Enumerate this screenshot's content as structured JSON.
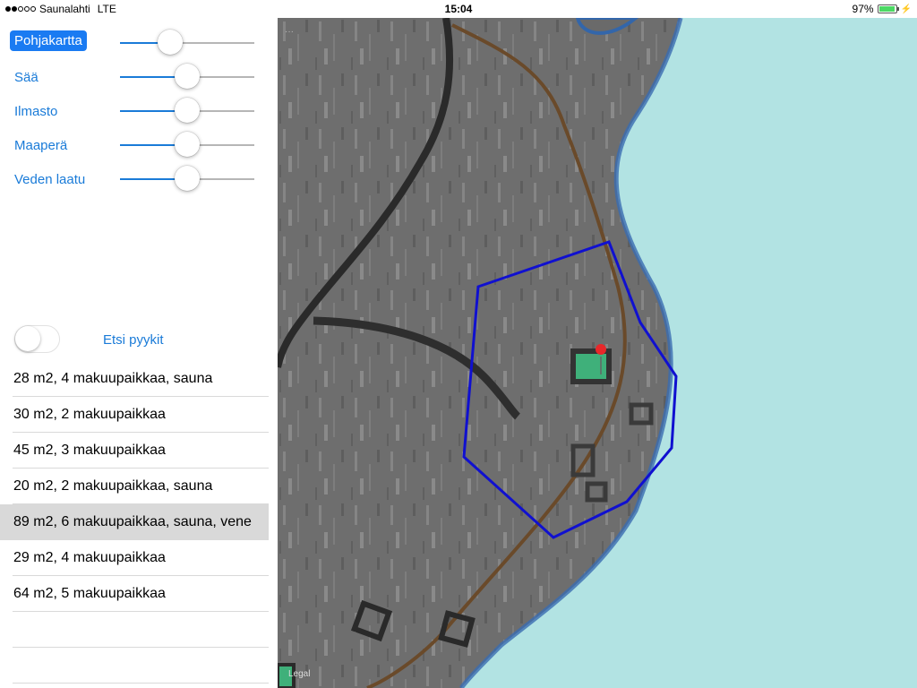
{
  "status_bar": {
    "carrier": "Saunalahti",
    "network": "LTE",
    "time": "15:04",
    "battery_percent": "97%",
    "signal_bars_filled": 2,
    "signal_bars_total": 5
  },
  "layers": [
    {
      "label": "Pohjakartta",
      "selected": true,
      "value": 0.37
    },
    {
      "label": "Sää",
      "selected": false,
      "value": 0.5
    },
    {
      "label": "Ilmasto",
      "selected": false,
      "value": 0.5
    },
    {
      "label": "Maaperä",
      "selected": false,
      "value": 0.5
    },
    {
      "label": "Veden laatu",
      "selected": false,
      "value": 0.5
    }
  ],
  "search_toggle": {
    "label": "Etsi pyykit",
    "on": false
  },
  "cabins": [
    {
      "label": "28 m2, 4 makuupaikkaa, sauna",
      "highlighted": false
    },
    {
      "label": "30 m2, 2 makuupaikkaa",
      "highlighted": false
    },
    {
      "label": "45 m2, 3 makuupaikkaa",
      "highlighted": false
    },
    {
      "label": "20 m2, 2 makuupaikkaa, sauna",
      "highlighted": false
    },
    {
      "label": "89 m2, 6 makuupaikkaa, sauna, vene",
      "highlighted": true
    },
    {
      "label": "29 m2, 4 makuupaikkaa",
      "highlighted": false
    },
    {
      "label": "64 m2, 5 makuupaikkaa",
      "highlighted": false
    },
    {
      "label": "",
      "highlighted": false
    },
    {
      "label": "",
      "highlighted": false
    }
  ],
  "map": {
    "legal_label": "Legal",
    "water_color": "#b2e3e3",
    "land_color": "#6c6c6c",
    "boundary_color": "#1010d0",
    "pin_color": "#e8272a"
  },
  "colors": {
    "accent": "#1a7bd8"
  }
}
